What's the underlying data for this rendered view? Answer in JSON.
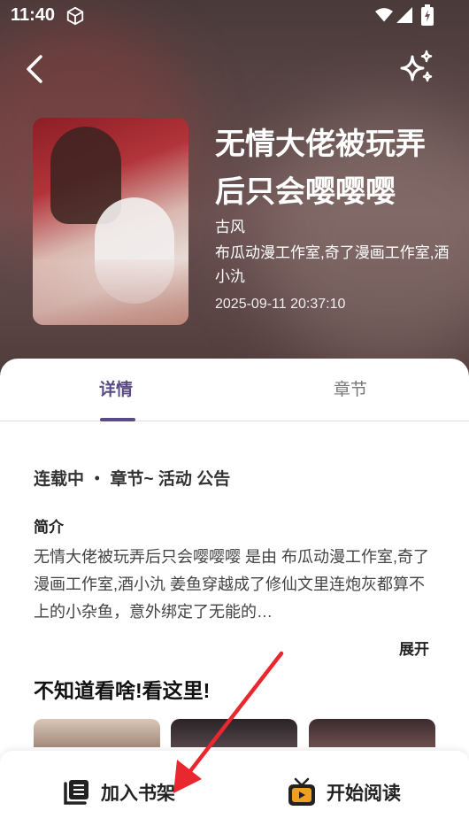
{
  "status_bar": {
    "time": "11:40"
  },
  "book": {
    "title": "无情大佬被玩弄后只会嘤嘤嘤",
    "genre": "古风",
    "authors": "布瓜动漫工作室,奇了漫画工作室,酒小氿",
    "date": "2025-09-11 20:37:10"
  },
  "tabs": [
    {
      "label": "详情",
      "active": true
    },
    {
      "label": "章节",
      "active": false
    }
  ],
  "detail": {
    "meta": "连载中 ・ 章节~ 活动 公告",
    "intro_title": "简介",
    "intro_text": "无情大佬被玩弄后只会嘤嘤嘤 是由 布瓜动漫工作室,奇了漫画工作室,酒小氿 姜鱼穿越成了修仙文里连炮灰都算不上的小杂鱼，意外绑定了无能的…",
    "expand_label": "展开"
  },
  "recommend": {
    "title": "不知道看啥!看这里!"
  },
  "bottom_bar": {
    "add_shelf_label": "加入书架",
    "start_read_label": "开始阅读"
  },
  "colors": {
    "accent": "#5a4a86",
    "arrow": "#e8282e",
    "tv_icon": "#f0a020"
  }
}
